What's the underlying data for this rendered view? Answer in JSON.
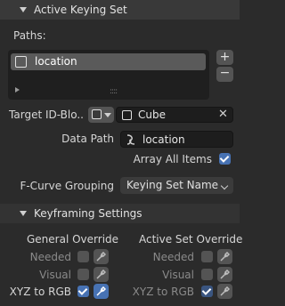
{
  "active_keying_set": {
    "header": "Active Keying Set",
    "paths_label": "Paths:",
    "paths": [
      {
        "name": "location"
      }
    ],
    "add_symbol": "+",
    "remove_symbol": "−",
    "target_label": "Target ID-Blo..",
    "target_value": "Cube",
    "data_path_label": "Data Path",
    "data_path_value": "location",
    "array_all_items_label": "Array All Items",
    "array_all_items_checked": true,
    "fcurve_grouping_label": "F-Curve Grouping",
    "fcurve_grouping_value": "Keying Set Name"
  },
  "keyframing_settings": {
    "header": "Keyframing Settings",
    "general_override": {
      "title": "General Override",
      "rows": [
        {
          "label": "Needed",
          "checked": false,
          "active": false
        },
        {
          "label": "Visual",
          "checked": false,
          "active": false
        },
        {
          "label": "XYZ to RGB",
          "checked": true,
          "active": true
        }
      ]
    },
    "active_set_override": {
      "title": "Active Set Override",
      "rows": [
        {
          "label": "Needed",
          "checked": false,
          "active": false
        },
        {
          "label": "Visual",
          "checked": false,
          "active": false
        },
        {
          "label": "XYZ to RGB",
          "checked": true,
          "active": false
        }
      ]
    }
  },
  "colors": {
    "accent": "#4772b3",
    "background": "#2b2b2b",
    "header": "#393939"
  }
}
